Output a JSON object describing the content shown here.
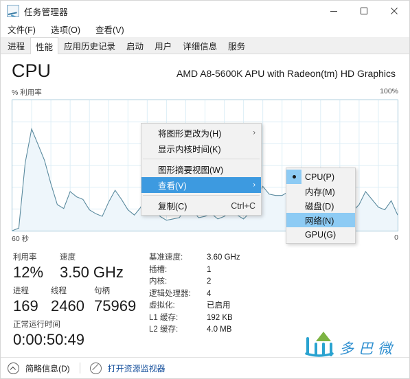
{
  "window": {
    "title": "任务管理器",
    "icon": "task-manager-icon",
    "minimize": "—",
    "maximize": "▢",
    "close": "✕"
  },
  "menubar": {
    "items": [
      {
        "label": "文件(F)"
      },
      {
        "label": "选项(O)"
      },
      {
        "label": "查看(V)"
      }
    ]
  },
  "tabs": {
    "items": [
      {
        "label": "进程",
        "active": false
      },
      {
        "label": "性能",
        "active": true
      },
      {
        "label": "应用历史记录",
        "active": false
      },
      {
        "label": "启动",
        "active": false
      },
      {
        "label": "用户",
        "active": false
      },
      {
        "label": "详细信息",
        "active": false
      },
      {
        "label": "服务",
        "active": false
      }
    ]
  },
  "header": {
    "title": "CPU",
    "subtitle": "AMD A8-5600K APU with Radeon(tm) HD Graphics"
  },
  "chart_axes": {
    "y_label": "% 利用率",
    "y_max": "100%",
    "x_left": "60 秒",
    "x_right": "0"
  },
  "chart_data": {
    "type": "area",
    "title": "% 利用率",
    "xlabel": "60 秒 → 0",
    "ylabel": "% 利用率",
    "ylim": [
      0,
      100
    ],
    "xlim": [
      0,
      60
    ],
    "grid": true,
    "legend": "none",
    "line_color": "#5a8a9e",
    "fill_color": "#eef6fb",
    "series": [
      {
        "name": "CPU 利用率",
        "values": [
          0,
          2,
          52,
          78,
          66,
          54,
          36,
          20,
          17,
          30,
          26,
          24,
          16,
          13,
          11,
          22,
          31,
          24,
          16,
          12,
          18,
          34,
          22,
          11,
          8,
          9,
          10,
          17,
          16,
          10,
          11,
          13,
          9,
          11,
          15,
          12,
          9,
          14,
          23,
          34,
          28,
          27,
          27,
          30,
          26,
          19,
          15,
          14,
          17,
          16,
          13,
          11,
          13,
          15,
          20,
          30,
          24,
          18,
          16,
          23,
          12
        ]
      }
    ]
  },
  "context_menu": {
    "items": [
      {
        "label": "将图形更改为(H)",
        "arrow": "›",
        "accel": "",
        "selected": false
      },
      {
        "label": "显示内核时间(K)",
        "arrow": "",
        "accel": "",
        "selected": false
      },
      {
        "separator": true
      },
      {
        "label": "图形摘要视图(W)",
        "arrow": "",
        "accel": "",
        "selected": false
      },
      {
        "label": "查看(V)",
        "arrow": "›",
        "accel": "",
        "selected": true
      },
      {
        "separator": true
      },
      {
        "label": "复制(C)",
        "arrow": "",
        "accel": "Ctrl+C",
        "selected": false
      }
    ]
  },
  "submenu": {
    "items": [
      {
        "label": "CPU(P)",
        "checked": true,
        "selected": false
      },
      {
        "label": "内存(M)",
        "checked": false,
        "selected": false
      },
      {
        "label": "磁盘(D)",
        "checked": false,
        "selected": false
      },
      {
        "label": "网络(N)",
        "checked": false,
        "selected": true
      },
      {
        "label": "GPU(G)",
        "checked": false,
        "selected": false
      }
    ]
  },
  "stats": {
    "left": [
      [
        {
          "label": "利用率",
          "value": "12%"
        },
        {
          "label": "速度",
          "value": "3.50 GHz"
        }
      ],
      [
        {
          "label": "进程",
          "value": "169"
        },
        {
          "label": "线程",
          "value": "2460"
        },
        {
          "label": "句柄",
          "value": "75969"
        }
      ],
      [
        {
          "label": "正常运行时间",
          "value": "0:00:50:49"
        }
      ]
    ],
    "right": [
      {
        "key": "基准速度:",
        "value": "3.60 GHz"
      },
      {
        "key": "插槽:",
        "value": "1"
      },
      {
        "key": "内核:",
        "value": "2"
      },
      {
        "key": "逻辑处理器:",
        "value": "4"
      },
      {
        "key": "虚拟化:",
        "value": "已启用"
      },
      {
        "key": "L1 缓存:",
        "value": "192 KB"
      },
      {
        "key": "L2 缓存:",
        "value": "4.0 MB"
      }
    ]
  },
  "watermark": {
    "url": "www.306w.com"
  },
  "statusbar": {
    "fewer_details": "简略信息(D)",
    "resource_monitor": "打开资源监视器"
  },
  "colors": {
    "accent": "#3d9ae0",
    "submenu_highlight": "#8dcbf4",
    "chart_line": "#5a8a9e",
    "chart_fill": "#eef6fb",
    "chart_border": "#9fc5d8",
    "link": "#16509c"
  }
}
